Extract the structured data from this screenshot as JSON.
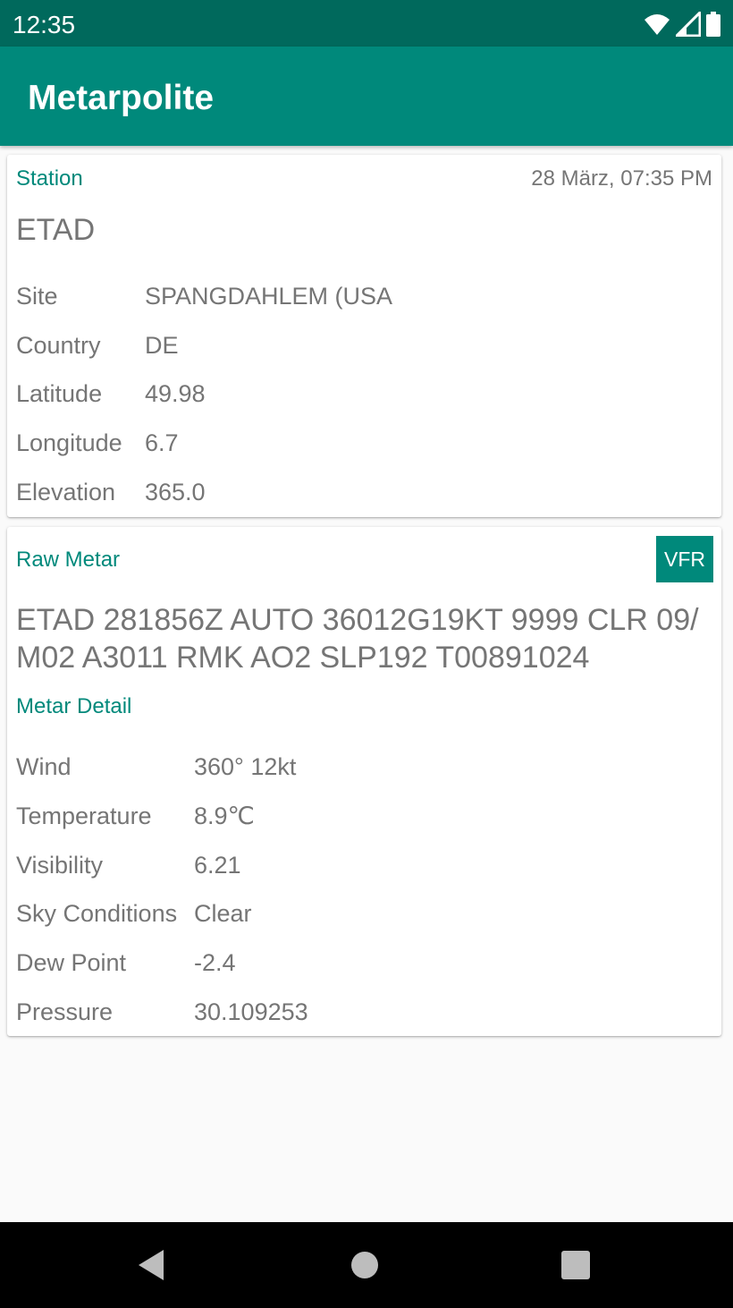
{
  "status_bar": {
    "time": "12:35",
    "icons": [
      "wifi-icon",
      "signal-icon",
      "battery-icon"
    ]
  },
  "app_bar": {
    "title": "Metarpolite"
  },
  "station_card": {
    "section_label": "Station",
    "timestamp": "28 März, 07:35 PM",
    "station_id": "ETAD",
    "rows": [
      {
        "label": "Site",
        "value": "SPANGDAHLEM (USA"
      },
      {
        "label": "Country",
        "value": "DE"
      },
      {
        "label": "Latitude",
        "value": "49.98"
      },
      {
        "label": "Longitude",
        "value": "6.7"
      },
      {
        "label": "Elevation",
        "value": "365.0"
      }
    ]
  },
  "metar_card": {
    "section_label": "Raw Metar",
    "flight_category": "VFR",
    "raw_line_1": "ETAD 281856Z AUTO 36012G19KT 9999 CLR 09/",
    "raw_line_2": "M02 A3011 RMK AO2 SLP192 T00891024",
    "detail_label": "Metar Detail",
    "rows": [
      {
        "label": "Wind",
        "value": "360° 12kt"
      },
      {
        "label": "Temperature",
        "value": "8.9℃"
      },
      {
        "label": "Visibility",
        "value": "6.21"
      },
      {
        "label": "Sky Conditions",
        "value": "Clear"
      },
      {
        "label": "Dew Point",
        "value": "-2.4"
      },
      {
        "label": "Pressure",
        "value": "30.109253"
      }
    ]
  },
  "colors": {
    "accent": "#00897b",
    "status_bar": "#00695c",
    "text_secondary": "#757575",
    "background": "#fafafa"
  },
  "nav_bar": {
    "icons": [
      "back-icon",
      "home-icon",
      "recents-icon"
    ]
  }
}
